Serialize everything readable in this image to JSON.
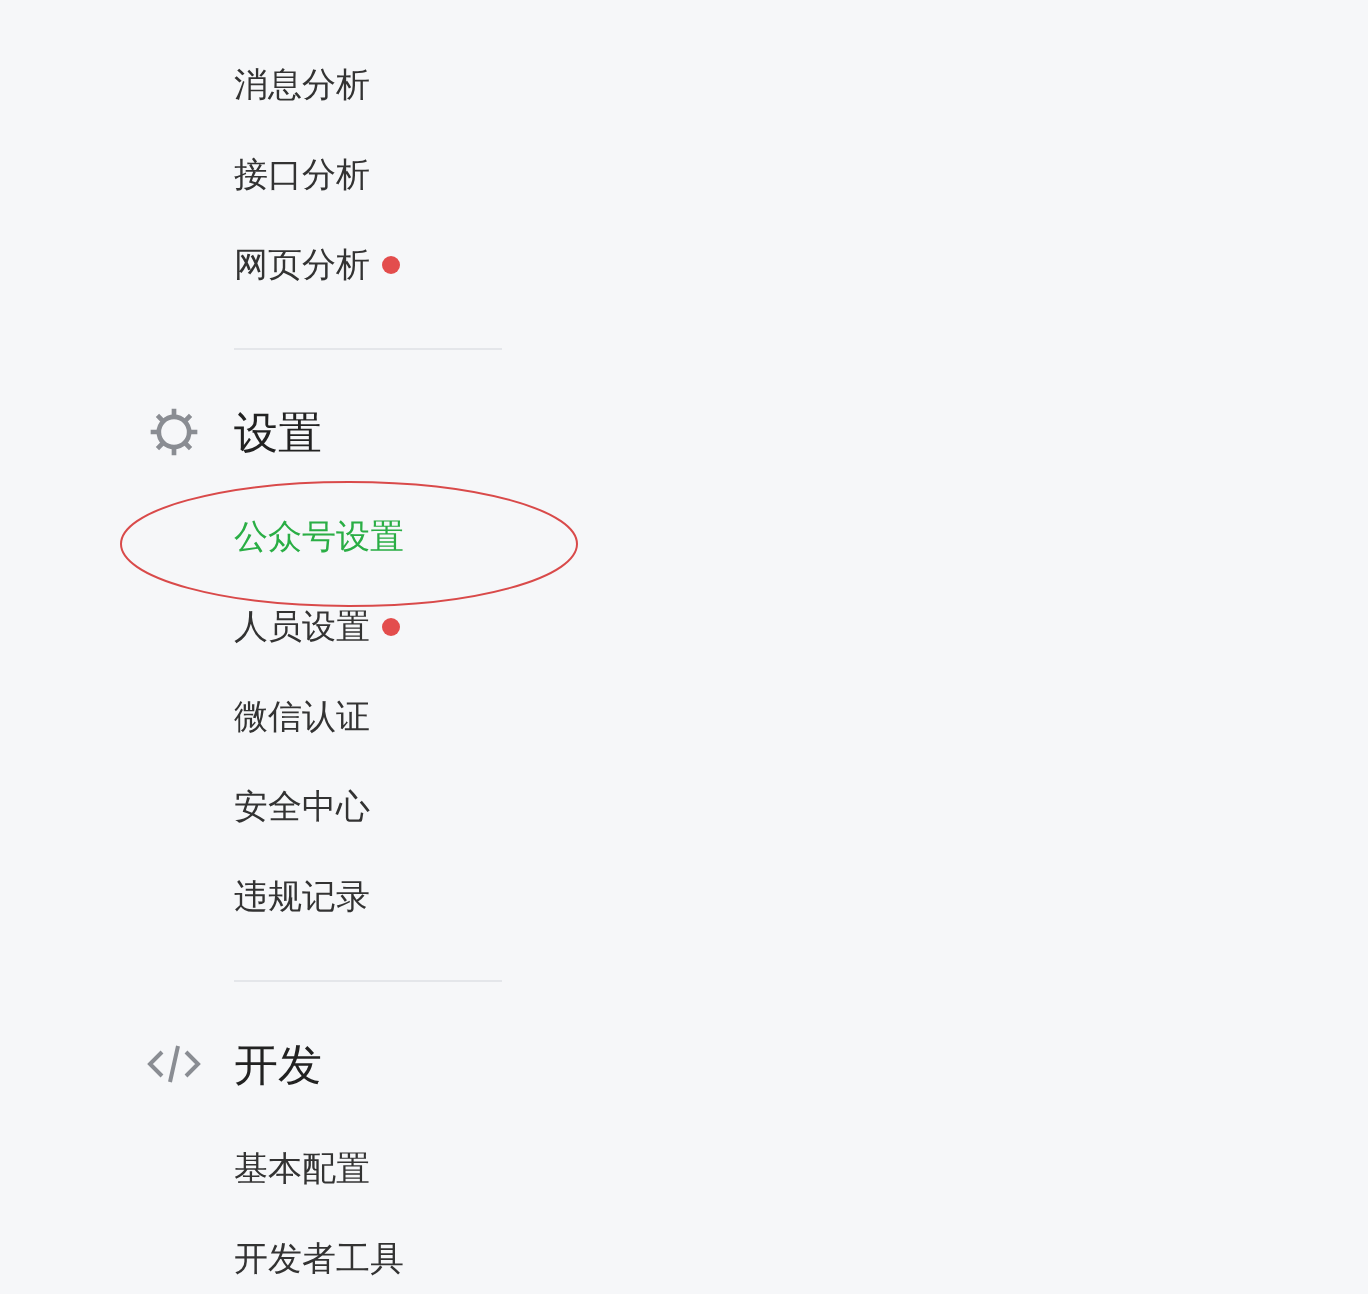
{
  "sections": [
    {
      "items": [
        {
          "label": "消息分析",
          "selected": false,
          "badge": false
        },
        {
          "label": "接口分析",
          "selected": false,
          "badge": false
        },
        {
          "label": "网页分析",
          "selected": false,
          "badge": true
        }
      ]
    },
    {
      "title": "设置",
      "kind": "gear",
      "items": [
        {
          "label": "公众号设置",
          "selected": true,
          "badge": false
        },
        {
          "label": "人员设置",
          "selected": false,
          "badge": true
        },
        {
          "label": "微信认证",
          "selected": false,
          "badge": false
        },
        {
          "label": "安全中心",
          "selected": false,
          "badge": false
        },
        {
          "label": "违规记录",
          "selected": false,
          "badge": false
        }
      ]
    },
    {
      "title": "开发",
      "kind": "code",
      "items": [
        {
          "label": "基本配置",
          "selected": false,
          "badge": false
        },
        {
          "label": "开发者工具",
          "selected": false,
          "badge": false
        }
      ]
    }
  ]
}
